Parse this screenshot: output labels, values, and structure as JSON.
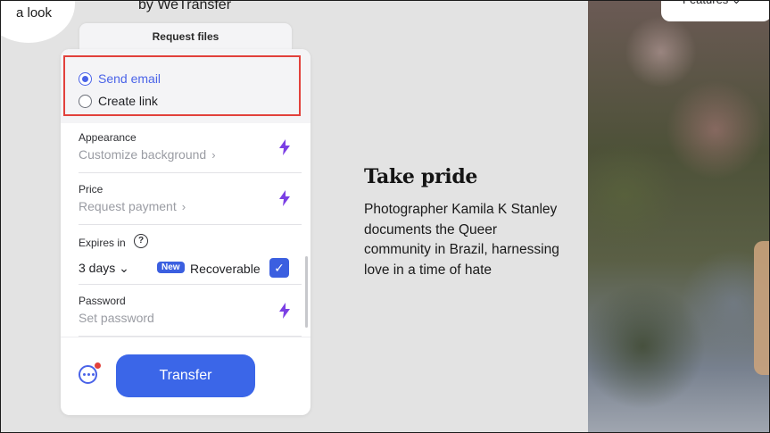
{
  "header": {
    "badge_text": "a look",
    "by_text": "by WeTransfer",
    "features_button": "Features ⌄"
  },
  "tab": {
    "label": "Request files"
  },
  "options": {
    "send_email": "Send email",
    "create_link": "Create link",
    "selected": "Send email"
  },
  "rows": {
    "appearance_label": "Appearance",
    "appearance_value": "Customize background",
    "price_label": "Price",
    "price_value": "Request payment",
    "expires_label": "Expires in",
    "expires_value": "3 days",
    "new_badge": "New",
    "recoverable": "Recoverable",
    "password_label": "Password",
    "password_value": "Set password"
  },
  "footer": {
    "transfer": "Transfer"
  },
  "article": {
    "headline": "Take pride",
    "description": "Photographer Kamila K Stanley documents the Queer community in Brazil, harnessing love in a time of hate"
  },
  "colors": {
    "accent": "#3b66e8",
    "bolt": "#7b3fe4",
    "highlight": "#e2413b"
  },
  "icons": [
    "bolt-icon",
    "help-icon",
    "check-icon",
    "more-icon",
    "chevron-right-icon",
    "chevron-down-icon"
  ]
}
